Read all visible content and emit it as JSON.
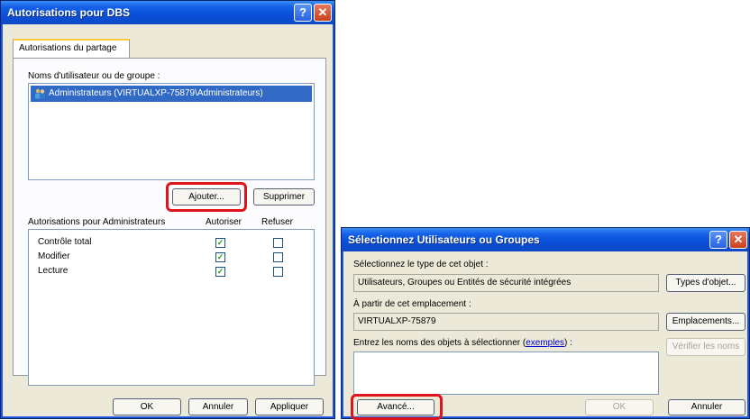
{
  "dialog1": {
    "title": "Autorisations pour DBS",
    "tab_label": "Autorisations du partage",
    "users_label": "Noms d'utilisateur ou de groupe :",
    "users": [
      "Administrateurs (VIRTUALXP-75879\\Administrateurs)"
    ],
    "add_button": "Ajouter...",
    "remove_button": "Supprimer",
    "permissions_header": "Autorisations pour Administrateurs",
    "allow_header": "Autoriser",
    "deny_header": "Refuser",
    "permissions": [
      {
        "name": "Contrôle total",
        "allow": true,
        "deny": false
      },
      {
        "name": "Modifier",
        "allow": true,
        "deny": false
      },
      {
        "name": "Lecture",
        "allow": true,
        "deny": false
      }
    ],
    "ok_button": "OK",
    "cancel_button": "Annuler",
    "apply_button": "Appliquer"
  },
  "dialog2": {
    "title": "Sélectionnez Utilisateurs ou Groupes",
    "object_type_label": "Sélectionnez le type de cet objet :",
    "object_type_value": "Utilisateurs, Groupes ou Entités de sécurité intégrées",
    "object_types_button": "Types d'objet...",
    "location_label": "À partir de cet emplacement :",
    "location_value": "VIRTUALXP-75879",
    "locations_button": "Emplacements...",
    "names_label_prefix": "Entrez les noms des objets à sélectionner (",
    "names_label_link": "exemples",
    "names_label_suffix": ") :",
    "check_names_button": "Vérifier les noms",
    "advanced_button": "Avancé...",
    "ok_button": "OK",
    "cancel_button": "Annuler"
  },
  "titlebar_buttons": {
    "help": "?",
    "close": "✕"
  },
  "colors": {
    "titlebar": "#0b4fd8",
    "highlight": "#e0141a",
    "selection": "#316ac5"
  }
}
